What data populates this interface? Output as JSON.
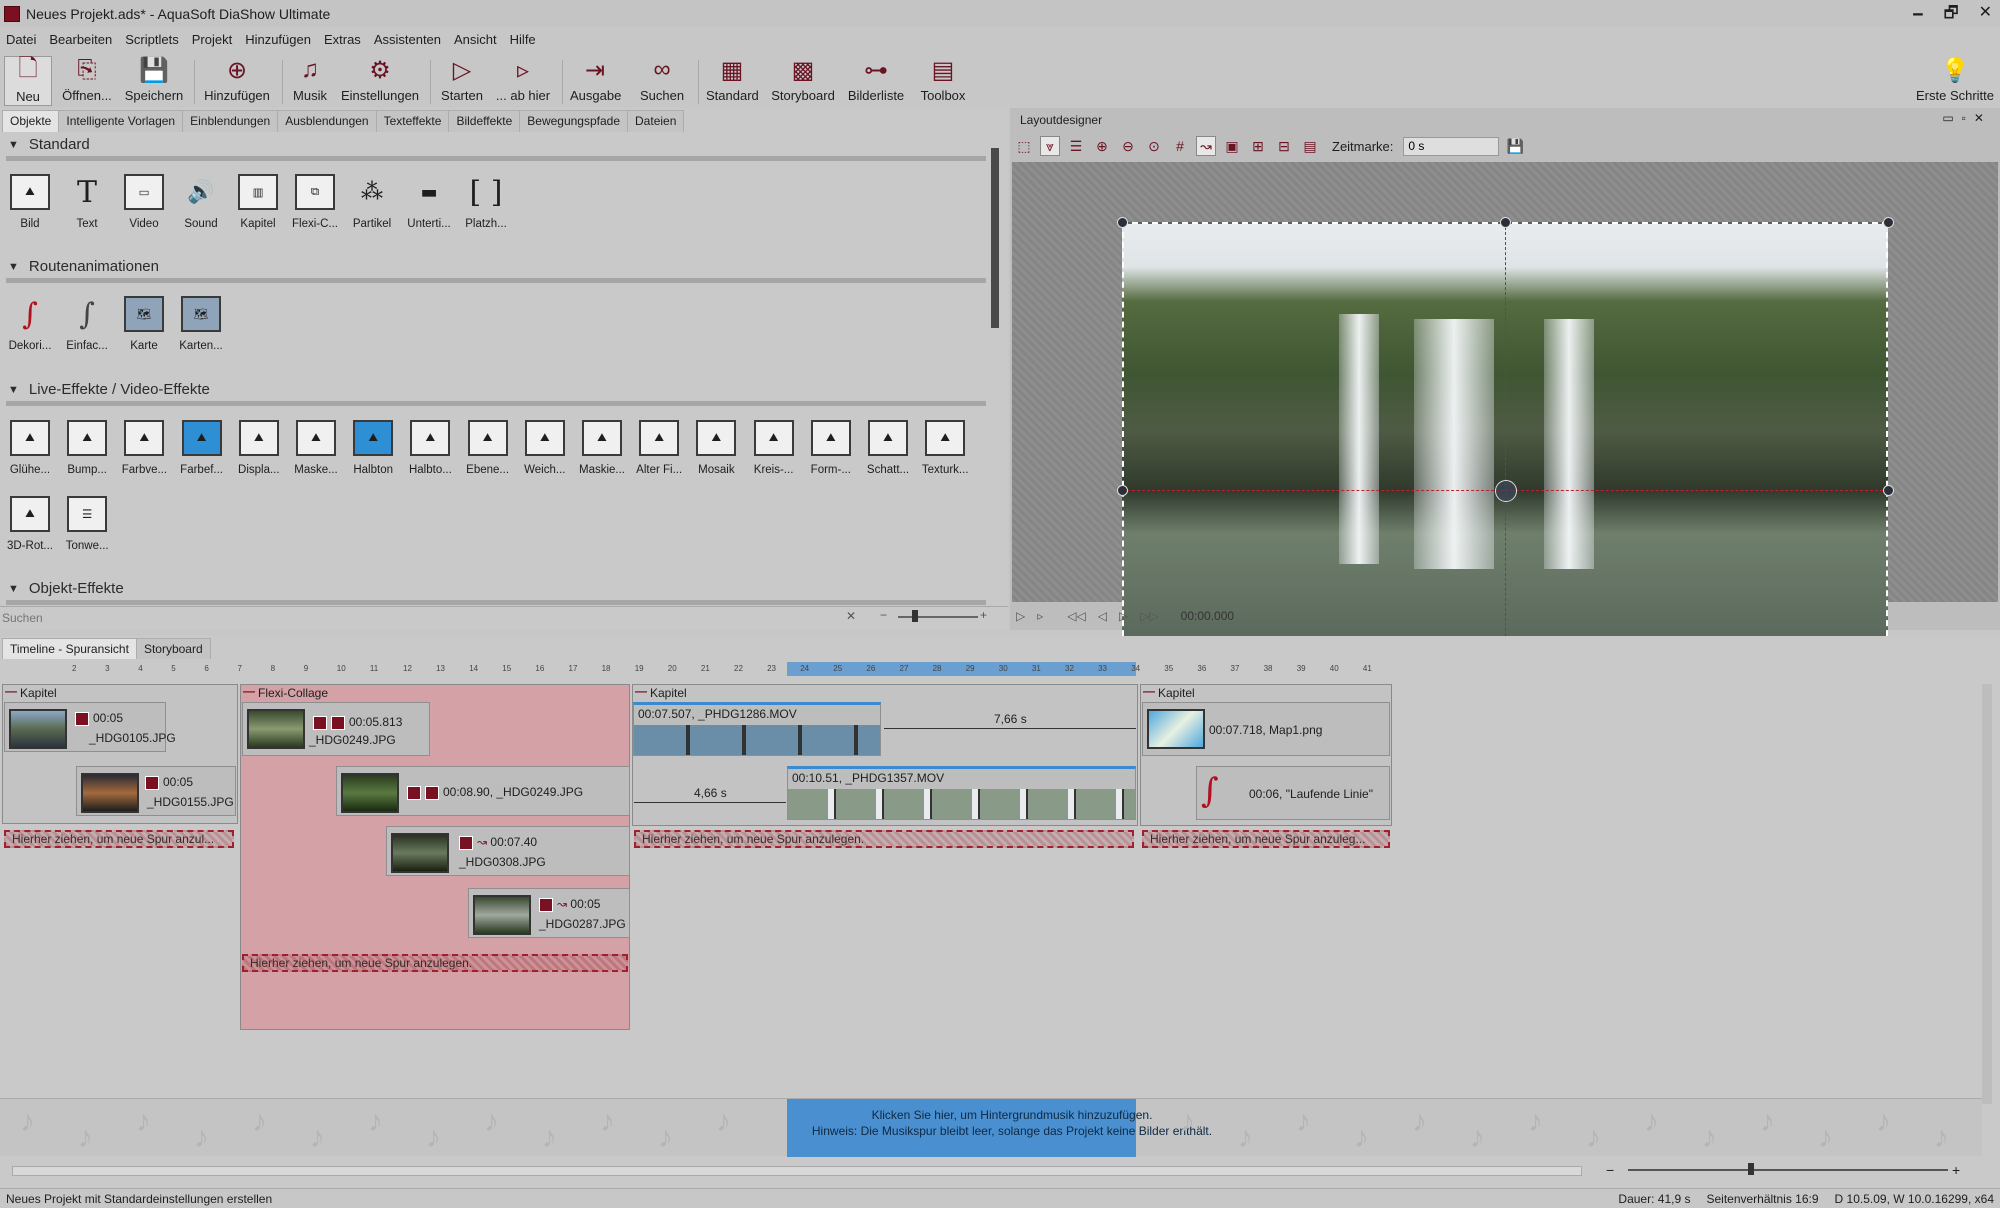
{
  "window": {
    "title": "Neues Projekt.ads* - AquaSoft DiaShow Ultimate",
    "controls": [
      "🗕",
      "🗗",
      "✕"
    ]
  },
  "menu": [
    "Datei",
    "Bearbeiten",
    "Scriptlets",
    "Projekt",
    "Hinzufügen",
    "Extras",
    "Assistenten",
    "Ansicht",
    "Hilfe"
  ],
  "toolbar": {
    "neu": "Neu",
    "oeffnen": "Öffnen...",
    "speichern": "Speichern",
    "hinzufuegen": "Hinzufügen",
    "musik": "Musik",
    "einstellungen": "Einstellungen",
    "starten": "Starten",
    "abhier": "... ab hier",
    "ausgabe": "Ausgabe",
    "suchen": "Suchen",
    "standard": "Standard",
    "storyboard": "Storyboard",
    "bilderliste": "Bilderliste",
    "toolbox": "Toolbox",
    "erste_schritte": "Erste Schritte"
  },
  "left_tabs": [
    "Objekte",
    "Intelligente Vorlagen",
    "Einblendungen",
    "Ausblendungen",
    "Texteffekte",
    "Bildeffekte",
    "Bewegungspfade",
    "Dateien"
  ],
  "sections": {
    "standard": "Standard",
    "routen": "Routenanimationen",
    "live": "Live-Effekte / Video-Effekte",
    "objekt": "Objekt-Effekte"
  },
  "standard_items": [
    "Bild",
    "Text",
    "Video",
    "Sound",
    "Kapitel",
    "Flexi-C...",
    "Partikel",
    "Unterti...",
    "Platzh..."
  ],
  "routen_items": [
    "Dekori...",
    "Einfac...",
    "Karte",
    "Karten..."
  ],
  "live_items": [
    "Glühe...",
    "Bump...",
    "Farbve...",
    "Farbef...",
    "Displa...",
    "Maske...",
    "Halbton",
    "Halbto...",
    "Ebene...",
    "Weich...",
    "Maskie...",
    "Alter Fi...",
    "Mosaik",
    "Kreis-...",
    "Form-...",
    "Schatt...",
    "Texturk..."
  ],
  "live_items_row2": [
    "3D-Rot...",
    "Tonwe..."
  ],
  "search": {
    "placeholder": "Suchen"
  },
  "layout": {
    "title": "Layoutdesigner",
    "zeitmarke_label": "Zeitmarke:",
    "zeitmarke_value": "0 s",
    "time": "00:00.000"
  },
  "timeline": {
    "tabs": [
      "Timeline - Spuransicht",
      "Storyboard"
    ],
    "ruler": [
      "2",
      "3",
      "4",
      "5",
      "6",
      "7",
      "8",
      "9",
      "10",
      "11",
      "12",
      "13",
      "14",
      "15",
      "16",
      "17",
      "18",
      "19",
      "20",
      "21",
      "22",
      "23",
      "24",
      "25",
      "26",
      "27",
      "28",
      "29",
      "30",
      "31",
      "32",
      "33",
      "34",
      "35",
      "36",
      "37",
      "38",
      "39",
      "40",
      "41"
    ],
    "chapters": [
      "Kapitel",
      "Flexi-Collage",
      "Kapitel",
      "Kapitel"
    ],
    "clips": {
      "c1": {
        "dur": "00:05",
        "name": "_HDG0105.JPG"
      },
      "c2": {
        "dur": "00:05",
        "name": "_HDG0155.JPG"
      },
      "c3": {
        "dur": "00:05.813",
        "name": "_HDG0249.JPG"
      },
      "c4": {
        "dur": "00:08.90, _HDG0249.JPG"
      },
      "c5": {
        "dur": "00:07.40",
        "name": "_HDG0308.JPG"
      },
      "c6": {
        "dur": "00:05",
        "name": "_HDG0287.JPG"
      },
      "c7": {
        "dur": "00:07.507, _PHDG1286.MOV"
      },
      "c8": {
        "dur": "00:10.51, _PHDG1357.MOV"
      },
      "c9": {
        "dur": "00:07.718, Map1.png"
      },
      "c10": {
        "dur": "00:06, \"Laufende Linie\""
      }
    },
    "gap1": "7,66 s",
    "gap2": "4,66 s",
    "drop_long": "Hierher ziehen, um neue Spur anzulegen.",
    "drop_short": "Hierher ziehen, um neue Spur anzul...",
    "drop_short2": "Hierher ziehen, um neue Spur anzuleg...",
    "music_line1": "Klicken Sie hier, um Hintergrundmusik hinzuzufügen.",
    "music_line2": "Hinweis: Die Musikspur bleibt leer, solange das Projekt keine Bilder enthält."
  },
  "status": {
    "left": "Neues Projekt mit Standardeinstellungen erstellen",
    "dauer": "Dauer: 41,9 s",
    "seiten": "Seitenverhältnis 16:9",
    "version": "D 10.5.09, W 10.0.16299, x64"
  },
  "colors": {
    "accent": "#6a1322",
    "selection": "#4a90d0",
    "collage": "#d7a3a8"
  }
}
